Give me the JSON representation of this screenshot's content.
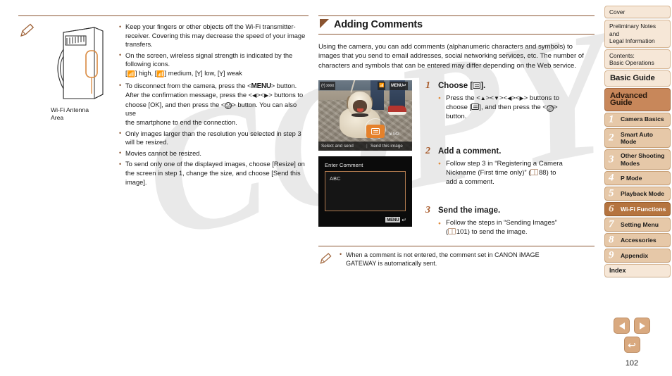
{
  "watermark": {
    "text": "COPY"
  },
  "left": {
    "figure": {
      "caption_line1": "Wi-Fi Antenna",
      "caption_line2": "Area"
    },
    "notes": [
      "Keep your fingers or other objects off the Wi-Fi transmitter-receiver. Covering this may decrease the speed of your image transfers.",
      "On the screen, wireless signal strength is indicated by the following icons.",
      "To disconnect from the camera, press the <MENU> button. After the confirmation message, press the <q><r> buttons to choose [OK], and then press the <FUNC/SET> button. You can also use the smartphone to end the connection.",
      "Only images larger than the resolution you selected in step 3 will be resized.",
      "Movies cannot be resized.",
      "To send only one of the displayed images, choose [Resize] on the screen in step 1, change the size, and choose [Send this image]."
    ],
    "note1_part1": "Keep your fingers or other objects off the Wi-Fi transmitter-",
    "note1_part2": "receiver. Covering this may decrease the speed of your image",
    "note1_part3": "transfers.",
    "note2_part1": "On the screen, wireless signal strength is indicated by the",
    "note2_part2": "following icons.",
    "signal_levels": {
      "high": "high,",
      "medium": "medium,",
      "low": "low,",
      "weak": "weak"
    },
    "note3_pre": "To disconnect from the camera, press the <",
    "note3_menu": "MENU",
    "note3_post": "> button.",
    "note3_l2a": "After the confirmation message, press the <",
    "note3_l2b": "><",
    "note3_l2c": "> buttons to",
    "note3_l3a": "choose [OK], and then press the <",
    "note3_l3b": "> button. You can also use",
    "note3_l4": "the smartphone to end the connection.",
    "note4_l1": "Only images larger than the resolution you selected in step 3",
    "note4_l2": "will be resized.",
    "note5": "Movies cannot be resized.",
    "note6_l1": "To send only one of the displayed images, choose [Resize] on",
    "note6_l2": "the screen in step 1, change the size, and choose [Send this",
    "note6_l3": "image]."
  },
  "right": {
    "section_title": "Adding Comments",
    "intro": "Using the camera, you can add comments (alphanumeric characters and symbols) to images that you send to email addresses, social networking services, etc. The number of characters and symbols that can be entered may differ depending on the Web service.",
    "steps": [
      {
        "num": "1",
        "title_pre": "Choose [",
        "title_post": "].",
        "body_l1_a": "Press the <",
        "body_l1_b": "><",
        "body_l1_c": "><",
        "body_l1_d": "><",
        "body_l1_e": "> buttons to",
        "body_l2_a": "choose [",
        "body_l2_b": "], and then press the <",
        "body_l2_c": ">",
        "body_l3": "button."
      },
      {
        "num": "2",
        "title": "Add a comment.",
        "body_l1": "Follow step 3 in “Registering a Camera",
        "body_l2_a": "Nickname (First time only)” (",
        "body_l2_b": "88) to",
        "body_l3": "add a comment."
      },
      {
        "num": "3",
        "title": "Send the image.",
        "body_l1": "Follow the steps in “Sending Images”",
        "body_l2_a": "(",
        "body_l2_b": "101) to send the image."
      }
    ],
    "shot1": {
      "wifi_label": "xxxx",
      "menu_label": "MENU",
      "caption_left": "Select and send",
      "caption_right": "Send this image",
      "size_label": "M2"
    },
    "shot2": {
      "title": "Enter Comment",
      "value": "ABC",
      "menu_label": "MENU"
    },
    "bottom_note_l1": "When a comment is not entered, the comment set in CANON iMAGE",
    "bottom_note_l2": "GATEWAY is automatically sent."
  },
  "sidebar": {
    "items": [
      {
        "label": "Cover",
        "kind": "plain"
      },
      {
        "label": "Preliminary Notes and\nLegal Information",
        "kind": "plain"
      },
      {
        "label": "Contents:\nBasic Operations",
        "kind": "plain"
      },
      {
        "label": "Basic Guide",
        "kind": "big"
      },
      {
        "label": "Advanced Guide",
        "kind": "guide-active"
      },
      {
        "num": "1",
        "label": "Camera Basics",
        "kind": "chapter"
      },
      {
        "num": "2",
        "label": "Smart Auto\nMode",
        "kind": "chapter"
      },
      {
        "num": "3",
        "label": "Other Shooting\nModes",
        "kind": "chapter"
      },
      {
        "num": "4",
        "label": "P Mode",
        "kind": "chapter"
      },
      {
        "num": "5",
        "label": "Playback Mode",
        "kind": "chapter"
      },
      {
        "num": "6",
        "label": "Wi-Fi Functions",
        "kind": "chapter-active"
      },
      {
        "num": "7",
        "label": "Setting Menu",
        "kind": "chapter"
      },
      {
        "num": "8",
        "label": "Accessories",
        "kind": "chapter"
      },
      {
        "num": "9",
        "label": "Appendix",
        "kind": "chapter"
      },
      {
        "label": "Index",
        "kind": "index"
      }
    ],
    "labels": {
      "cover": "Cover",
      "prelim_l1": "Preliminary Notes and",
      "prelim_l2": "Legal Information",
      "contents_l1": "Contents:",
      "contents_l2": "Basic Operations",
      "basic_guide": "Basic Guide",
      "advanced_guide": "Advanced Guide",
      "ch1": "Camera Basics",
      "ch2_l1": "Smart Auto",
      "ch2_l2": "Mode",
      "ch3_l1": "Other Shooting",
      "ch3_l2": "Modes",
      "ch4": "P Mode",
      "ch5": "Playback Mode",
      "ch6": "Wi-Fi Functions",
      "ch7": "Setting Menu",
      "ch8": "Accessories",
      "ch9": "Appendix",
      "index": "Index",
      "n1": "1",
      "n2": "2",
      "n3": "3",
      "n4": "4",
      "n5": "5",
      "n6": "6",
      "n7": "7",
      "n8": "8",
      "n9": "9"
    }
  },
  "nav": {
    "prev_label": "previous-page",
    "next_label": "next-page",
    "back_label": "back",
    "page_number": "102"
  },
  "colors": {
    "accent_brown": "#8a5430",
    "tab_light": "#f0dcc8",
    "tab_chapter": "#e6c8a8",
    "tab_active": "#b5743f",
    "guide_active": "#c8875a",
    "orange_bullet": "#e08b3c",
    "step_num": "#a85a2a",
    "nav_button": "#d9a97f"
  }
}
